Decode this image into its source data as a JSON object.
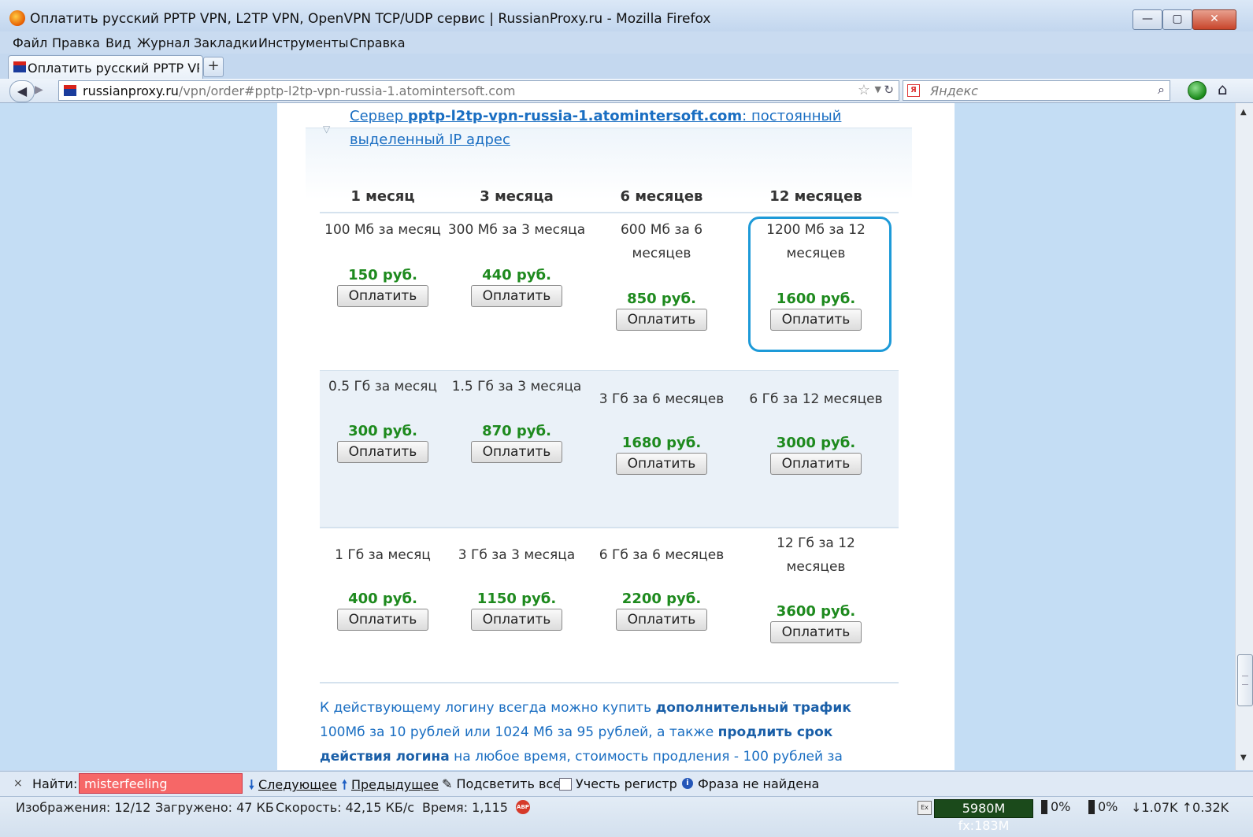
{
  "window": {
    "title": "Оплатить русский PPTP VPN, L2TP VPN, OpenVPN TCP/UDP сервис | RussianProxy.ru - Mozilla Firefox",
    "min_label": "▭",
    "max_label": "▢",
    "close_label": "✕"
  },
  "menu": [
    "Файл",
    "Правка",
    "Вид",
    "Журнал",
    "Закладки",
    "Инструменты",
    "Справка"
  ],
  "tab": {
    "label": "Оплатить русский PPTP VP...",
    "new_tab_label": "+"
  },
  "nav": {
    "url_host": "russianproxy.ru",
    "url_path": "/vpn/order#pptp-l2tp-vpn-russia-1.atomintersoft.com",
    "search_placeholder": "Яндекс",
    "search_engine_letter": "Я"
  },
  "server": {
    "prefix": "Сервер ",
    "host": "pptp-l2tp-vpn-russia-1.atomintersoft.com",
    "suffix": ": постоянный выделенный IP адрес"
  },
  "headers": [
    "1 месяц",
    "3 месяца",
    "6 месяцев",
    "12 месяцев"
  ],
  "pay_label": "Оплатить",
  "plans": [
    [
      {
        "desc": "100 Мб за месяц",
        "price": "150 руб."
      },
      {
        "desc": "300 Мб за 3 месяца",
        "price": "440 руб."
      },
      {
        "desc": "600 Мб за 6 месяцев",
        "price": "850 руб."
      },
      {
        "desc": "1200 Мб за 12 месяцев",
        "price": "1600 руб."
      }
    ],
    [
      {
        "desc": "0.5 Гб за месяц",
        "price": "300 руб."
      },
      {
        "desc": "1.5 Гб за 3 месяца",
        "price": "870 руб."
      },
      {
        "desc": "3 Гб за 6 месяцев",
        "price": "1680 руб."
      },
      {
        "desc": "6 Гб за 12 месяцев",
        "price": "3000 руб."
      }
    ],
    [
      {
        "desc": "1 Гб за месяц",
        "price": "400 руб."
      },
      {
        "desc": "3 Гб за 3 месяца",
        "price": "1150 руб."
      },
      {
        "desc": "6 Гб за 6 месяцев",
        "price": "2200 руб."
      },
      {
        "desc": "12 Гб за 12 месяцев",
        "price": "3600 руб."
      }
    ]
  ],
  "info": {
    "t1": "К действующему логину всегда можно купить ",
    "b1": "дополнительный трафик",
    "t2": " 100Мб за 10 рублей или 1024 Мб за 95 рублей, а также ",
    "b2": "продлить срок действия логина",
    "t3": " на любое время, стоимость продления - 100 рублей за"
  },
  "find": {
    "close": "×",
    "label": "Найти:",
    "value": "misterfeeling",
    "next": "Следующее",
    "prev": "Предыдущее",
    "highlight": "Подсветить все",
    "match_case": "Учесть регистр",
    "status": "Фраза не найдена"
  },
  "status": {
    "images": "Изображения: 12/12",
    "loaded": "Загружено: 47 КБ",
    "speed": "Скорость: 42,15 КБ/с",
    "time": "Время: 1,115",
    "abp": "ABP",
    "ex": "Ex",
    "memory": "5980M fx:183M",
    "cpu1": "0%",
    "cpu2": "0%",
    "traffic": "↓1.07K ↑0.32K"
  }
}
